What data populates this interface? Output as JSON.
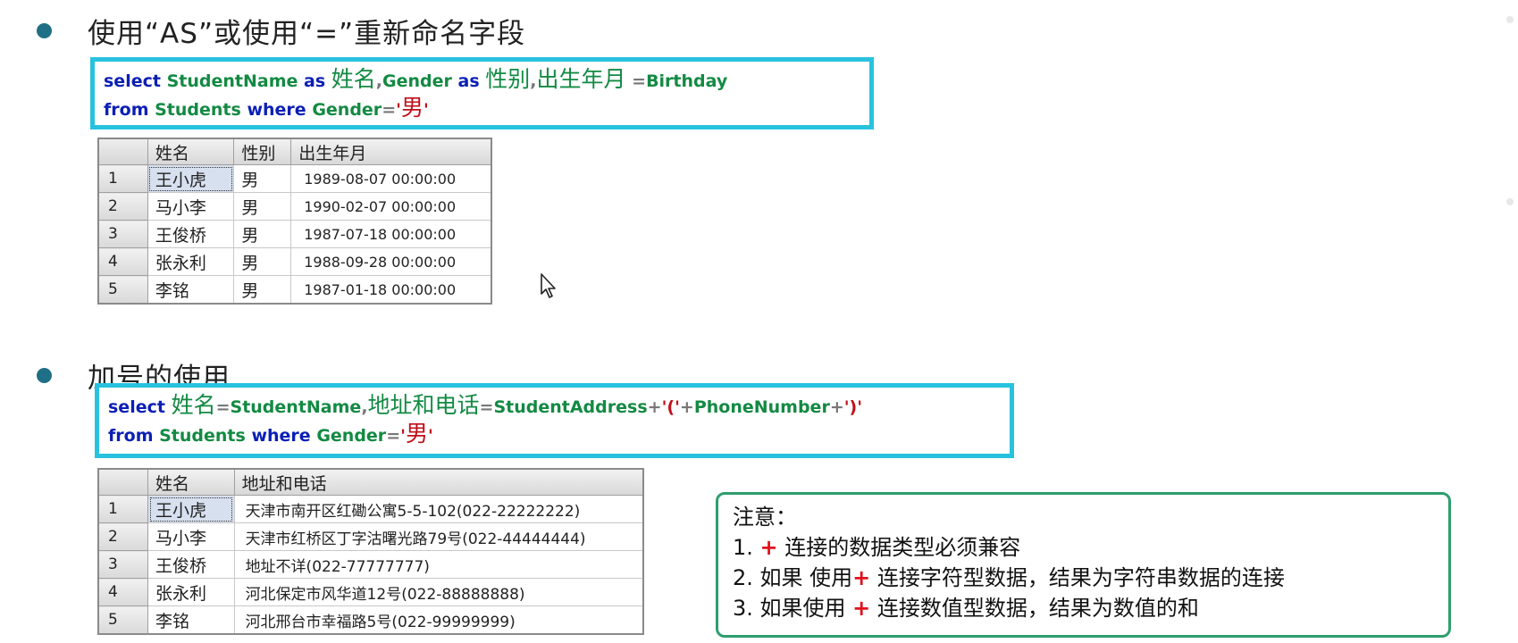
{
  "section1": {
    "heading": "使用“AS”或使用“=”重新命名字段",
    "sql": {
      "select_kw": "select",
      "col1": "StudentName",
      "as1": "as",
      "alias1": "姓名",
      "comma1": ",",
      "col2": "Gender",
      "as2": "as",
      "alias2": "性别",
      "comma2": ",",
      "alias3": "出生年月",
      "eq": "=",
      "col3": "Birthday",
      "from_kw": "from",
      "table": "Students",
      "where_kw": "where",
      "cond_col": "Gender",
      "cond_eq": "=",
      "quote_open": "'",
      "value": "男",
      "quote_close": "'"
    },
    "result": {
      "columns": [
        "姓名",
        "性别",
        "出生年月"
      ],
      "rows": [
        {
          "num": "1",
          "name": "王小虎",
          "gender": "男",
          "date": "1989-08-07 00:00:00"
        },
        {
          "num": "2",
          "name": "马小李",
          "gender": "男",
          "date": "1990-02-07 00:00:00"
        },
        {
          "num": "3",
          "name": "王俊桥",
          "gender": "男",
          "date": "1987-07-18 00:00:00"
        },
        {
          "num": "4",
          "name": "张永利",
          "gender": "男",
          "date": "1988-09-28 00:00:00"
        },
        {
          "num": "5",
          "name": "李铭",
          "gender": "男",
          "date": "1987-01-18 00:00:00"
        }
      ]
    }
  },
  "section2": {
    "heading": "加号的使用",
    "sql": {
      "select_kw": "select",
      "alias1": "姓名",
      "eq1": "=",
      "col1": "StudentName",
      "comma1": ",",
      "alias2": "地址和电话",
      "eq2": "=",
      "col2": "StudentAddress",
      "plus1": "+",
      "str_open": "'('",
      "plus2": "+",
      "col3": "PhoneNumber",
      "plus3": "+",
      "str_close": "')'",
      "from_kw": "from",
      "table": "Students",
      "where_kw": "where",
      "cond_col": "Gender",
      "cond_eq": "=",
      "quote_open": "'",
      "value": "男",
      "quote_close": "'"
    },
    "result": {
      "columns": [
        "姓名",
        "地址和电话"
      ],
      "rows": [
        {
          "num": "1",
          "name": "王小虎",
          "addr": "天津市南开区红磡公寓5-5-102(022-22222222)"
        },
        {
          "num": "2",
          "name": "马小李",
          "addr": "天津市红桥区丁字沽曙光路79号(022-44444444)"
        },
        {
          "num": "3",
          "name": "王俊桥",
          "addr": "地址不详(022-77777777)"
        },
        {
          "num": "4",
          "name": "张永利",
          "addr": "河北保定市风华道12号(022-88888888)"
        },
        {
          "num": "5",
          "name": "李铭",
          "addr": "河北邢台市幸福路5号(022-99999999)"
        }
      ]
    }
  },
  "note": {
    "title": "注意：",
    "items": [
      {
        "prefix": "1. ",
        "plus": "+",
        "text": " 连接的数据类型必须兼容"
      },
      {
        "prefix": "2. 如果 使用",
        "plus": "+",
        "text": " 连接字符型数据，结果为字符串数据的连接"
      },
      {
        "prefix": "3. 如果使用 ",
        "plus": "+",
        "text": " 连接数值型数据，结果为数值的和"
      }
    ]
  },
  "colors": {
    "sql_box_border": "#28c2de",
    "note_border": "#2e9e6e",
    "keyword": "#0b1fb5",
    "identifier": "#138a43",
    "string": "#c0101a",
    "plus": "#e0121e",
    "bullet": "#1f6f86"
  },
  "icons": {
    "cursor": "mouse-pointer-icon",
    "bullet": "bullet-dot-icon"
  }
}
